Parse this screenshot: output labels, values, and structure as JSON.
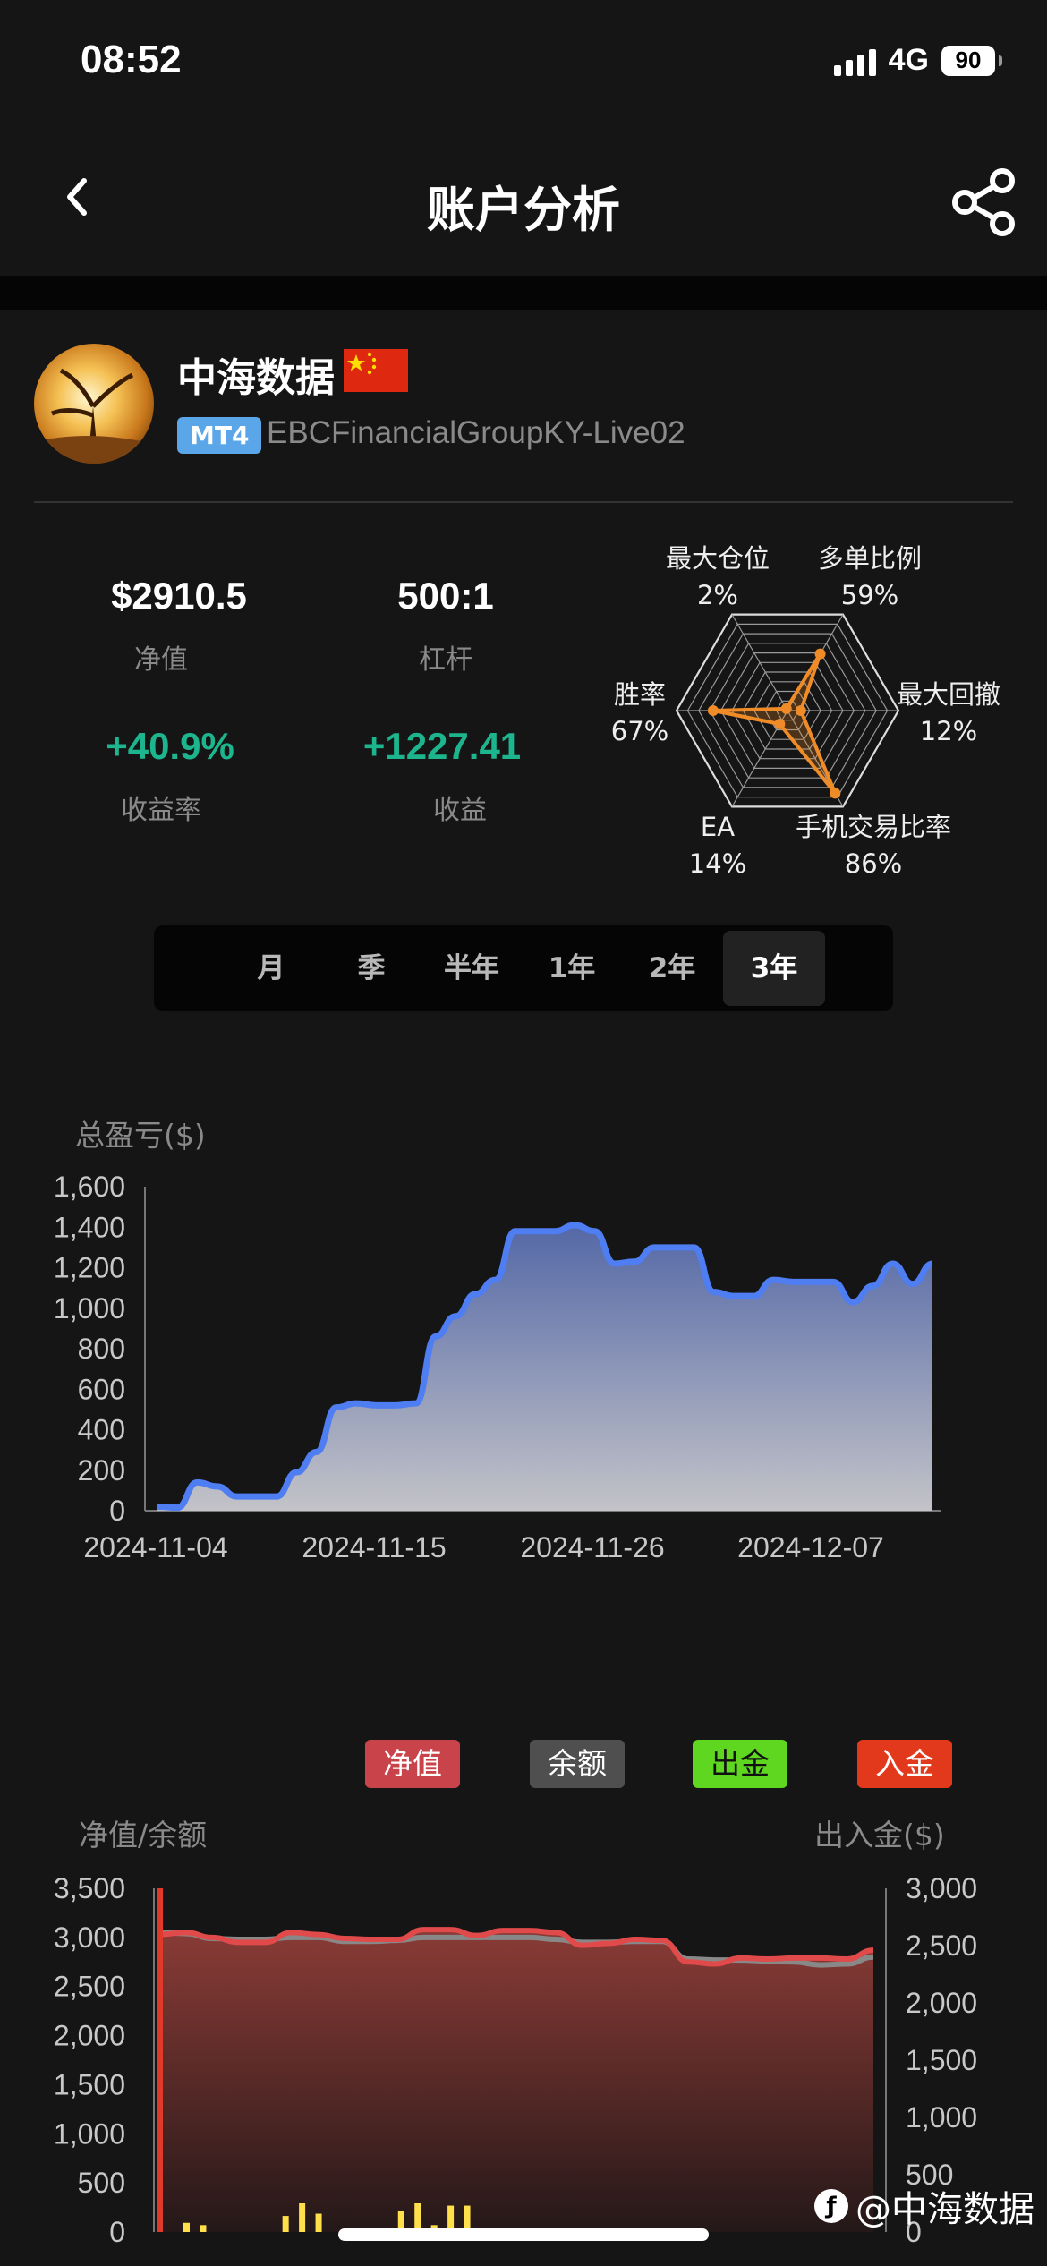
{
  "status": {
    "time": "08:52",
    "network": "4G",
    "battery": "90"
  },
  "nav": {
    "title": "账户分析",
    "back_icon": "chevron-left-icon",
    "share_icon": "share-icon"
  },
  "profile": {
    "name": "中海数据",
    "flag": "china-flag",
    "platform_badge": "MT4",
    "server": "EBCFinancialGroupKY-Live02"
  },
  "stats": {
    "equity_value": "$2910.5",
    "equity_label": "净值",
    "leverage_value": "500:1",
    "leverage_label": "杠杆",
    "return_rate_value": "+40.9%",
    "return_rate_label": "收益率",
    "profit_value": "+1227.41",
    "profit_label": "收益"
  },
  "radar": [
    {
      "label": "最大仓位",
      "value": "2%",
      "fraction": 0.02
    },
    {
      "label": "多单比例",
      "value": "59%",
      "fraction": 0.59
    },
    {
      "label": "最大回撤",
      "value": "12%",
      "fraction": 0.12
    },
    {
      "label": "手机交易比率",
      "value": "86%",
      "fraction": 0.86
    },
    {
      "label": "EA",
      "value": "14%",
      "fraction": 0.14
    },
    {
      "label": "胜率",
      "value": "67%",
      "fraction": 0.67
    }
  ],
  "periods": {
    "items": [
      "月",
      "季",
      "半年",
      "1年",
      "2年",
      "3年"
    ],
    "selected": "3年"
  },
  "chart_data": [
    {
      "type": "area",
      "title": "",
      "ylabel": "总盈亏($)",
      "ylim": [
        0,
        1600
      ],
      "yticks": [
        "1,600",
        "1,400",
        "1,200",
        "1,000",
        "800",
        "600",
        "400",
        "200",
        "0"
      ],
      "xticks": [
        "2024-11-04",
        "2024-11-15",
        "2024-11-26",
        "2024-12-07"
      ],
      "series": [
        {
          "values": [
            20,
            15,
            140,
            120,
            70,
            70,
            70,
            190,
            290,
            510,
            530,
            520,
            520,
            530,
            860,
            960,
            1070,
            1140,
            1380,
            1380,
            1380,
            1410,
            1380,
            1220,
            1230,
            1300,
            1300,
            1300,
            1080,
            1060,
            1060,
            1140,
            1130,
            1130,
            1130,
            1030,
            1110,
            1220,
            1120,
            1220
          ]
        }
      ]
    },
    {
      "type": "area",
      "ylabel": "净值/余额",
      "y2label": "出入金($)",
      "ylim": [
        0,
        3500
      ],
      "y2lim": [
        0,
        3000
      ],
      "yticks": [
        "3,500",
        "3,000",
        "2,500",
        "2,000",
        "1,500",
        "1,000",
        "500",
        "0"
      ],
      "y2ticks": [
        "3,000",
        "2,500",
        "2,000",
        "1,500",
        "1,000",
        "500",
        "0"
      ],
      "legend": [
        "净值",
        "余额",
        "出金",
        "入金"
      ],
      "series": [
        {
          "name": "净值",
          "color": "#e04a4a",
          "values": [
            3030,
            3050,
            3000,
            2950,
            2950,
            3050,
            3030,
            2990,
            2980,
            2980,
            3080,
            3080,
            3020,
            3070,
            3070,
            3050,
            2920,
            2940,
            2980,
            2970,
            2750,
            2730,
            2790,
            2780,
            2790,
            2790,
            2780,
            2870
          ]
        },
        {
          "name": "余额",
          "color": "#888888",
          "values": [
            3050,
            3040,
            2990,
            2980,
            2980,
            3000,
            3000,
            2960,
            2960,
            2970,
            3000,
            3000,
            3000,
            3000,
            3000,
            2980,
            2950,
            2950,
            2960,
            2960,
            2780,
            2770,
            2770,
            2760,
            2750,
            2720,
            2730,
            2800
          ]
        },
        {
          "name": "出金",
          "color": "#ffe04a",
          "values": [
            0,
            80,
            60,
            0,
            0,
            0,
            0,
            140,
            250,
            160,
            0,
            0,
            0,
            0,
            180,
            250,
            60,
            230,
            230,
            0,
            0,
            0,
            0,
            0,
            0,
            0,
            0,
            0
          ]
        },
        {
          "name": "入金",
          "color": "#e03a2a",
          "values": [
            3000,
            0,
            0,
            0,
            0,
            0,
            0,
            0,
            0,
            0,
            0,
            0,
            0,
            0,
            0,
            0,
            0,
            0,
            0,
            0,
            0,
            0,
            0,
            0,
            0,
            0,
            0,
            0
          ]
        }
      ]
    }
  ],
  "legend_colors": {
    "净值": "#c9434a",
    "余额": "#4f4f4f",
    "出金": "#5fd61f",
    "入金": "#e2391d"
  },
  "watermark": "@中海数据"
}
